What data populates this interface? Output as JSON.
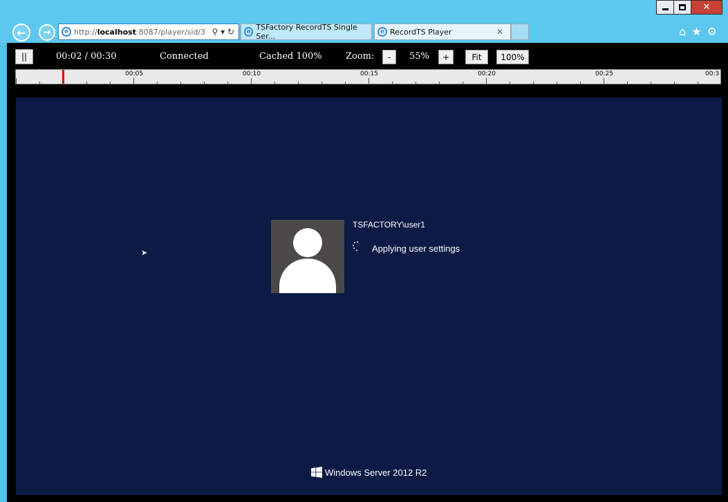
{
  "browser": {
    "address": {
      "scheme": "http://",
      "host": "localhost",
      "rest": ":8087/player/sid/3"
    },
    "tabs": [
      {
        "label": "TSFactory RecordTS Single Ser..."
      },
      {
        "label": "RecordTS Player"
      }
    ]
  },
  "player": {
    "pause_label": "||",
    "time": "00:02 / 00:30",
    "connection": "Connected",
    "cache": "Cached 100%",
    "zoom_label": "Zoom:",
    "zoom_minus": "-",
    "zoom_value": "55%",
    "zoom_plus": "+",
    "fit_label": "Fit",
    "full_label": "100%",
    "timeline": {
      "ticks": [
        "00:05",
        "00:10",
        "00:15",
        "00:20",
        "00:25",
        "00:3"
      ],
      "position_seconds": 2,
      "duration_seconds": 30
    }
  },
  "session": {
    "username": "TSFACTORY\\user1",
    "status": "Applying user settings",
    "brand": "Windows Server 2012 R2"
  }
}
